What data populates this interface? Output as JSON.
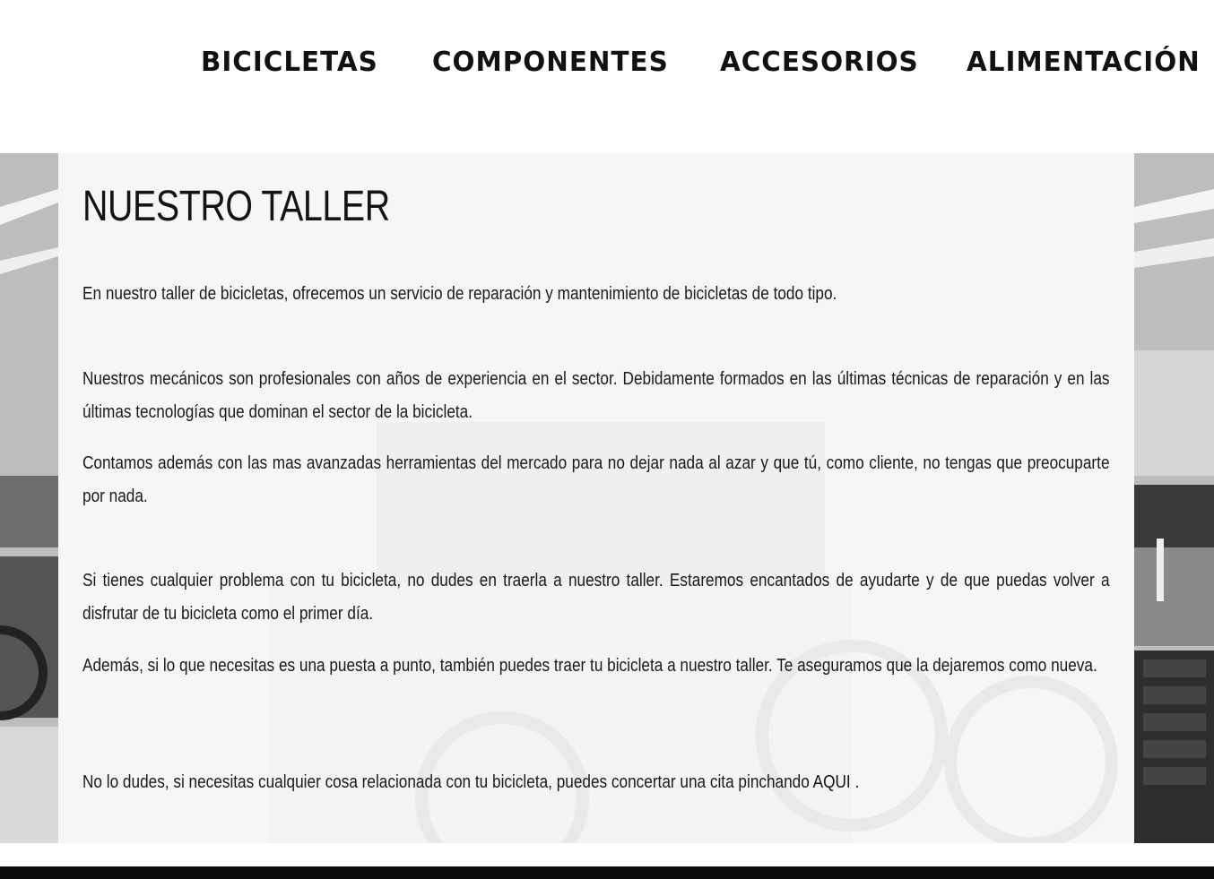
{
  "nav": {
    "items": [
      {
        "label": "BICICLETAS"
      },
      {
        "label": "COMPONENTES"
      },
      {
        "label": "ACCESORIOS"
      },
      {
        "label": "ALIMENTACIÓN"
      }
    ]
  },
  "main": {
    "title": "NUESTRO TALLER",
    "paragraphs": [
      "En nuestro taller de bicicletas, ofrecemos un servicio de reparación y mantenimiento de bicicletas de todo tipo.",
      "Nuestros mecánicos son profesionales con años de experiencia en el sector. Debidamente formados en las últimas técnicas de reparación y en las últimas tecnologías que dominan el sector de la bicicleta.",
      "Contamos además con las mas avanzadas herramientas del mercado para no dejar nada al azar y que tú, como cliente, no tengas que preocuparte por nada.",
      "Si tienes cualquier problema con tu bicicleta, no dudes en traerla a nuestro taller. Estaremos encantados de ayudarte y de que puedas volver a disfrutar de tu bicicleta como el primer día.",
      "Además, si lo que necesitas es una puesta a punto, también puedes traer tu bicicleta a nuestro taller. Te aseguramos que la dejaremos como nueva."
    ],
    "cta": {
      "text_before": "No lo dudes, si necesitas cualquier cosa relacionada con tu bicicleta, puedes concertar una cita pinchando ",
      "link_label": "AQUI",
      "text_after": " ."
    }
  },
  "colors": {
    "background": "#ffffff",
    "text": "#1a1a1a",
    "footer": "#0b0b0b"
  }
}
